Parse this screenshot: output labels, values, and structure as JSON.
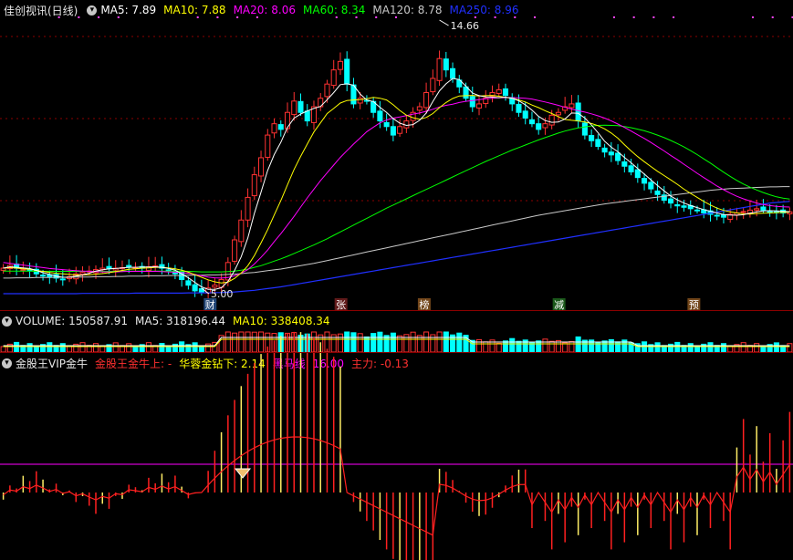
{
  "header": {
    "title": "佳创视讯(日线)",
    "ma": [
      {
        "label": "MA5: 7.89",
        "color": "#ffffff"
      },
      {
        "label": "MA10: 7.88",
        "color": "#ffff00"
      },
      {
        "label": "MA20: 8.06",
        "color": "#ff00ff"
      },
      {
        "label": "MA60: 8.34",
        "color": "#00ff00"
      },
      {
        "label": "MA120: 8.78",
        "color": "#c8c8c8"
      },
      {
        "label": "MA250: 8.96",
        "color": "#2030ff"
      }
    ]
  },
  "volume_header": {
    "title": "VOLUME: 150587.91",
    "ma5": "MA5: 318196.44",
    "ma10": "MA10: 338408.34"
  },
  "indicator_header": {
    "title": "金股王VIP金牛",
    "items": [
      {
        "label": "金股王金牛上: -",
        "color": "#ff3030"
      },
      {
        "label": "华蓉金钻下: 2.14",
        "color": "#ffff00"
      },
      {
        "label": "黑马线: 16.00",
        "color": "#ff00ff"
      },
      {
        "label": "主力: -0.13",
        "color": "#ff3030"
      }
    ]
  },
  "annotations": {
    "high": "14.66",
    "low": "5.00",
    "markers": [
      "财",
      "张",
      "榜",
      "减",
      "预"
    ]
  },
  "chart_data": {
    "type": "candlestick",
    "title": "佳创视讯(日线)",
    "n": 120,
    "y_range": [
      5.0,
      14.66
    ],
    "highest": 14.66,
    "lowest": 5.0,
    "price": [
      5.9,
      6.0,
      5.9,
      5.85,
      5.8,
      5.7,
      5.65,
      5.6,
      5.55,
      5.5,
      5.6,
      5.7,
      5.75,
      5.8,
      5.85,
      5.9,
      5.88,
      5.9,
      5.92,
      5.95,
      5.93,
      5.9,
      5.95,
      5.98,
      5.9,
      5.8,
      5.7,
      5.5,
      5.3,
      5.1,
      5.05,
      5.2,
      5.3,
      5.5,
      6.1,
      6.9,
      7.6,
      8.4,
      9.2,
      9.8,
      10.6,
      11.0,
      10.8,
      11.4,
      11.8,
      11.4,
      11.1,
      11.6,
      11.9,
      12.4,
      12.9,
      13.2,
      12.4,
      11.7,
      11.9,
      11.8,
      11.4,
      11.1,
      10.9,
      10.6,
      10.9,
      11.1,
      11.4,
      11.6,
      12.1,
      12.6,
      13.3,
      12.9,
      12.6,
      12.3,
      11.9,
      11.6,
      11.7,
      11.9,
      12.1,
      12.2,
      12.0,
      11.7,
      11.4,
      11.2,
      11.0,
      10.8,
      11.0,
      11.3,
      11.4,
      11.6,
      11.7,
      11.1,
      10.6,
      10.4,
      10.2,
      10.0,
      9.9,
      9.7,
      9.5,
      9.3,
      9.1,
      8.9,
      8.7,
      8.5,
      8.3,
      8.2,
      8.1,
      8.05,
      8.0,
      7.95,
      7.85,
      7.8,
      7.75,
      7.7,
      7.8,
      7.85,
      7.9,
      7.95,
      8.0,
      7.95,
      7.9,
      7.88,
      7.85,
      7.89
    ],
    "ma5": [
      5.9,
      5.95,
      5.93,
      5.91,
      5.89,
      5.82,
      5.74,
      5.68,
      5.62,
      5.58,
      5.58,
      5.62,
      5.66,
      5.72,
      5.8,
      5.84,
      5.88,
      5.89,
      5.91,
      5.93,
      5.93,
      5.94,
      5.94,
      5.95,
      5.93,
      5.89,
      5.83,
      5.7,
      5.56,
      5.4,
      5.24,
      5.15,
      5.15,
      5.21,
      5.43,
      5.82,
      6.3,
      6.97,
      7.84,
      8.58,
      9.35,
      9.91,
      10.35,
      10.87,
      11.2,
      11.34,
      11.45,
      11.54,
      11.61,
      11.85,
      12.1,
      12.38,
      12.41,
      12.36,
      12.05,
      11.84,
      11.78,
      11.58,
      11.4,
      11.18,
      11.02,
      10.94,
      10.97,
      11.12,
      11.38,
      11.78,
      12.16,
      12.41,
      12.6,
      12.56,
      12.33,
      12.08,
      11.99,
      11.95,
      11.94,
      11.92,
      11.94,
      11.9,
      11.81,
      11.67,
      11.48,
      11.26,
      11.11,
      11.05,
      11.06,
      11.17,
      11.38,
      11.37,
      11.2,
      10.96,
      10.68,
      10.38,
      10.17,
      10.01,
      9.81,
      9.62,
      9.42,
      9.22,
      9.02,
      8.82,
      8.63,
      8.45,
      8.31,
      8.2,
      8.11,
      8.04,
      7.97,
      7.91,
      7.85,
      7.79,
      7.78,
      7.77,
      7.79,
      7.84,
      7.89,
      7.92,
      7.93,
      7.92,
      7.91,
      7.89
    ],
    "ma10": [
      5.9,
      5.92,
      5.9,
      5.88,
      5.86,
      5.82,
      5.79,
      5.75,
      5.72,
      5.7,
      5.68,
      5.66,
      5.66,
      5.67,
      5.69,
      5.71,
      5.74,
      5.78,
      5.82,
      5.86,
      5.88,
      5.9,
      5.91,
      5.93,
      5.93,
      5.91,
      5.88,
      5.83,
      5.76,
      5.67,
      5.58,
      5.49,
      5.42,
      5.38,
      5.41,
      5.54,
      5.73,
      5.99,
      6.35,
      6.79,
      7.26,
      7.78,
      8.29,
      8.84,
      9.39,
      9.85,
      10.28,
      10.71,
      11.03,
      11.36,
      11.54,
      11.73,
      11.82,
      11.84,
      11.85,
      11.88,
      11.93,
      11.9,
      11.84,
      11.67,
      11.47,
      11.3,
      11.21,
      11.16,
      11.22,
      11.36,
      11.57,
      11.75,
      11.89,
      11.98,
      11.99,
      12.0,
      11.98,
      11.99,
      12.0,
      11.97,
      11.93,
      11.9,
      11.84,
      11.77,
      11.66,
      11.57,
      11.46,
      11.36,
      11.25,
      11.15,
      11.12,
      11.1,
      11.06,
      11.01,
      10.93,
      10.82,
      10.67,
      10.49,
      10.26,
      10.04,
      9.84,
      9.66,
      9.49,
      9.32,
      9.17,
      9.02,
      8.86,
      8.69,
      8.54,
      8.4,
      8.26,
      8.13,
      8.02,
      7.94,
      7.89,
      7.85,
      7.82,
      7.81,
      7.83,
      7.84,
      7.85,
      7.86,
      7.87,
      7.88
    ],
    "ma20": [
      6.1,
      6.07,
      6.04,
      6.01,
      5.98,
      5.95,
      5.92,
      5.89,
      5.87,
      5.85,
      5.83,
      5.81,
      5.8,
      5.79,
      5.78,
      5.77,
      5.77,
      5.77,
      5.78,
      5.79,
      5.79,
      5.79,
      5.79,
      5.79,
      5.78,
      5.77,
      5.76,
      5.74,
      5.72,
      5.68,
      5.63,
      5.59,
      5.56,
      5.55,
      5.57,
      5.63,
      5.72,
      5.85,
      6.05,
      6.28,
      6.54,
      6.84,
      7.12,
      7.42,
      7.73,
      8.06,
      8.38,
      8.69,
      8.99,
      9.27,
      9.54,
      9.81,
      10.05,
      10.28,
      10.5,
      10.72,
      10.88,
      11.03,
      11.13,
      11.2,
      11.24,
      11.29,
      11.34,
      11.38,
      11.44,
      11.51,
      11.59,
      11.65,
      11.69,
      11.75,
      11.79,
      11.82,
      11.85,
      11.88,
      11.9,
      11.92,
      11.92,
      11.92,
      11.91,
      11.9,
      11.87,
      11.82,
      11.77,
      11.71,
      11.65,
      11.58,
      11.52,
      11.46,
      11.41,
      11.35,
      11.28,
      11.2,
      11.1,
      10.99,
      10.87,
      10.74,
      10.61,
      10.48,
      10.34,
      10.19,
      10.04,
      9.88,
      9.73,
      9.57,
      9.41,
      9.25,
      9.1,
      8.95,
      8.8,
      8.67,
      8.55,
      8.44,
      8.35,
      8.27,
      8.2,
      8.15,
      8.11,
      8.08,
      8.07,
      8.06
    ],
    "ma60": [
      5.8,
      5.8,
      5.8,
      5.8,
      5.8,
      5.79,
      5.79,
      5.79,
      5.79,
      5.79,
      5.79,
      5.79,
      5.79,
      5.79,
      5.79,
      5.79,
      5.79,
      5.79,
      5.8,
      5.8,
      5.8,
      5.8,
      5.8,
      5.8,
      5.8,
      5.8,
      5.8,
      5.79,
      5.79,
      5.78,
      5.77,
      5.77,
      5.77,
      5.77,
      5.78,
      5.8,
      5.83,
      5.87,
      5.93,
      5.99,
      6.07,
      6.15,
      6.23,
      6.32,
      6.42,
      6.52,
      6.62,
      6.72,
      6.83,
      6.94,
      7.06,
      7.18,
      7.3,
      7.42,
      7.54,
      7.66,
      7.78,
      7.9,
      8.02,
      8.13,
      8.24,
      8.35,
      8.46,
      8.57,
      8.68,
      8.79,
      8.9,
      9.01,
      9.12,
      9.23,
      9.34,
      9.45,
      9.56,
      9.67,
      9.77,
      9.87,
      9.97,
      10.07,
      10.16,
      10.25,
      10.34,
      10.43,
      10.51,
      10.59,
      10.67,
      10.74,
      10.8,
      10.85,
      10.89,
      10.92,
      10.94,
      10.95,
      10.94,
      10.93,
      10.9,
      10.86,
      10.81,
      10.75,
      10.68,
      10.6,
      10.51,
      10.41,
      10.3,
      10.18,
      10.05,
      9.91,
      9.76,
      9.61,
      9.45,
      9.29,
      9.14,
      9.0,
      8.87,
      8.76,
      8.66,
      8.57,
      8.49,
      8.42,
      8.37,
      8.34
    ],
    "ma120": [
      5.55,
      5.55,
      5.56,
      5.56,
      5.56,
      5.57,
      5.57,
      5.57,
      5.58,
      5.58,
      5.58,
      5.59,
      5.59,
      5.59,
      5.6,
      5.6,
      5.6,
      5.61,
      5.61,
      5.62,
      5.62,
      5.62,
      5.63,
      5.63,
      5.63,
      5.64,
      5.64,
      5.64,
      5.65,
      5.65,
      5.65,
      5.66,
      5.66,
      5.67,
      5.68,
      5.69,
      5.71,
      5.73,
      5.75,
      5.78,
      5.81,
      5.84,
      5.87,
      5.91,
      5.95,
      5.99,
      6.03,
      6.07,
      6.12,
      6.17,
      6.22,
      6.27,
      6.32,
      6.37,
      6.42,
      6.47,
      6.52,
      6.57,
      6.62,
      6.67,
      6.72,
      6.77,
      6.82,
      6.87,
      6.92,
      6.97,
      7.02,
      7.07,
      7.12,
      7.17,
      7.22,
      7.27,
      7.32,
      7.37,
      7.42,
      7.47,
      7.52,
      7.57,
      7.62,
      7.67,
      7.72,
      7.77,
      7.81,
      7.85,
      7.89,
      7.93,
      7.97,
      8.01,
      8.05,
      8.09,
      8.13,
      8.17,
      8.2,
      8.23,
      8.26,
      8.29,
      8.32,
      8.35,
      8.38,
      8.41,
      8.44,
      8.47,
      8.5,
      8.53,
      8.56,
      8.59,
      8.62,
      8.65,
      8.67,
      8.69,
      8.71,
      8.72,
      8.73,
      8.74,
      8.75,
      8.76,
      8.77,
      8.77,
      8.78,
      8.78
    ],
    "ma250": [
      5.0,
      5.0,
      5.0,
      5.0,
      5.0,
      5.0,
      5.0,
      5.0,
      5.0,
      5.0,
      5.0,
      5.0,
      5.01,
      5.01,
      5.01,
      5.01,
      5.01,
      5.01,
      5.01,
      5.01,
      5.02,
      5.02,
      5.02,
      5.02,
      5.02,
      5.02,
      5.02,
      5.02,
      5.03,
      5.03,
      5.03,
      5.03,
      5.04,
      5.04,
      5.05,
      5.06,
      5.08,
      5.1,
      5.12,
      5.15,
      5.18,
      5.21,
      5.24,
      5.28,
      5.32,
      5.36,
      5.4,
      5.44,
      5.48,
      5.52,
      5.56,
      5.6,
      5.64,
      5.68,
      5.72,
      5.76,
      5.8,
      5.84,
      5.88,
      5.92,
      5.96,
      6.0,
      6.04,
      6.08,
      6.12,
      6.16,
      6.2,
      6.24,
      6.28,
      6.32,
      6.36,
      6.4,
      6.44,
      6.48,
      6.52,
      6.56,
      6.6,
      6.64,
      6.68,
      6.72,
      6.76,
      6.8,
      6.84,
      6.88,
      6.92,
      6.96,
      7.0,
      7.04,
      7.08,
      7.12,
      7.16,
      7.2,
      7.24,
      7.28,
      7.32,
      7.36,
      7.4,
      7.44,
      7.48,
      7.52,
      7.56,
      7.6,
      7.64,
      7.68,
      7.72,
      7.76,
      7.8,
      7.84,
      7.88,
      7.92,
      7.96,
      8.0,
      8.04,
      8.08,
      8.12,
      8.16,
      8.2,
      8.22,
      8.24,
      8.26
    ]
  },
  "colors": {
    "up": "#ff3232",
    "down": "#00ffff",
    "grid": "#8b0000",
    "ma5": "#ffffff",
    "ma10": "#ffff00",
    "ma20": "#ff00ff",
    "ma60": "#00ff00",
    "ma120": "#c8c8c8",
    "ma250": "#2030ff",
    "vol_ma5": "#ffffff",
    "vol_ma10": "#ffff00",
    "indicator_line": "#ff00ff",
    "indicator_red": "#ff2020",
    "indicator_yellow": "#ffee66"
  }
}
